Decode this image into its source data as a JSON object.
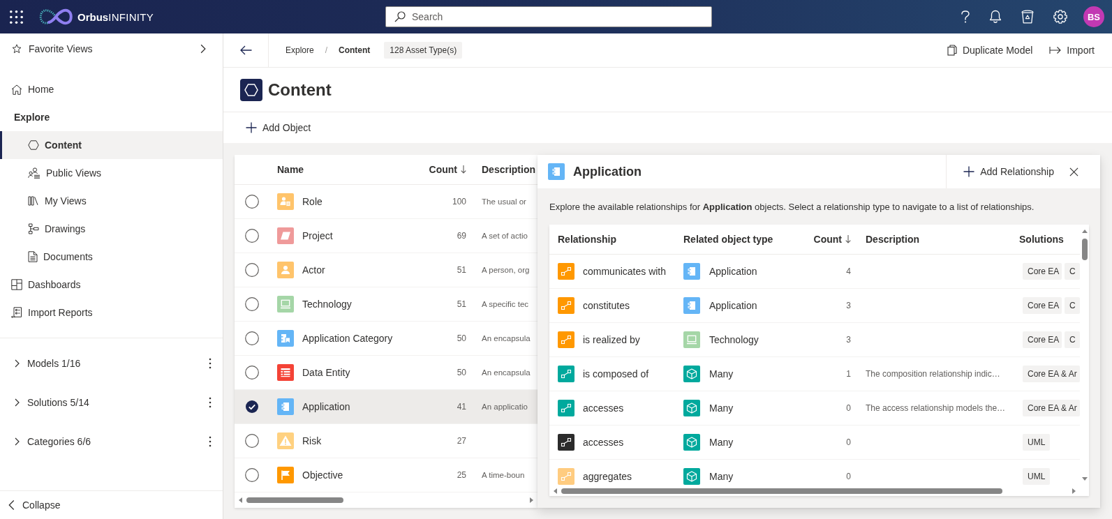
{
  "top_bar": {
    "logo": "**Orbus**INFINITY",
    "search": {
      "placeholder": "Search"
    },
    "avatar": "BS"
  },
  "sidebar": {
    "favorites": "Favorite Views",
    "nav": [
      {
        "label": "Home",
        "kind": "home",
        "selected": false
      },
      {
        "label": "Explore",
        "kind": "section",
        "selected": false,
        "children": [
          {
            "label": "Content",
            "kind": "hexagon",
            "selected": true
          },
          {
            "label": "Public Views",
            "kind": "people",
            "selected": false
          },
          {
            "label": "My Views",
            "kind": "books",
            "selected": false
          },
          {
            "label": "Drawings",
            "kind": "diagram",
            "selected": false
          },
          {
            "label": "Documents",
            "kind": "document",
            "selected": false
          }
        ]
      },
      {
        "label": "Dashboards",
        "kind": "dashboard",
        "selected": false
      },
      {
        "label": "Import Reports",
        "kind": "report",
        "selected": false
      }
    ],
    "groups": [
      {
        "label": "Models 1/16",
        "expanded": false
      },
      {
        "label": "Solutions 5/14",
        "expanded": false
      },
      {
        "label": "Categories 6/6",
        "expanded": false
      }
    ],
    "collapse": "Collapse"
  },
  "breadcrumb": {
    "items": [
      {
        "label": "Explore",
        "current": false
      },
      {
        "label": "Content",
        "current": true
      }
    ],
    "separator": "/",
    "badge": "128 Asset Type(s)",
    "actions": [
      {
        "label": "Duplicate Model",
        "kind": "duplicate"
      },
      {
        "label": "Import",
        "kind": "import"
      }
    ]
  },
  "page_title": "Content",
  "toolbar": [
    {
      "label": "Add Object",
      "kind": "add"
    }
  ],
  "content_table": {
    "columns": [
      {
        "label": "Name",
        "sorted": false
      },
      {
        "label": "Count",
        "sorted": true
      },
      {
        "label": "Description"
      }
    ],
    "rows": [
      {
        "selected": false,
        "kind": "role",
        "color": "#ffc46b",
        "name": "Role",
        "count": "100",
        "description": "The usual or"
      },
      {
        "selected": false,
        "kind": "project",
        "color": "#ef9a9a",
        "name": "Project",
        "count": "69",
        "description": "A set of actio"
      },
      {
        "selected": false,
        "kind": "actor",
        "color": "#ffc46b",
        "name": "Actor",
        "count": "51",
        "description": "A person, org"
      },
      {
        "selected": false,
        "kind": "technology",
        "color": "#a5d6a7",
        "name": "Technology",
        "count": "51",
        "description": "A specific tec"
      },
      {
        "selected": false,
        "kind": "application_category",
        "color": "#64b5f6",
        "name": "Application Category",
        "count": "50",
        "description": "An encapsula"
      },
      {
        "selected": false,
        "kind": "data_entity",
        "color": "#f44336",
        "name": "Data Entity",
        "count": "50",
        "description": "An encapsula"
      },
      {
        "selected": true,
        "kind": "application",
        "color": "#64b5f6",
        "name": "Application",
        "count": "41",
        "description": "An applicatio"
      },
      {
        "selected": false,
        "kind": "risk",
        "color": "#ffd180",
        "name": "Risk",
        "count": "27"
      },
      {
        "selected": false,
        "kind": "objective",
        "color": "#ff9800",
        "name": "Objective",
        "count": "25",
        "description": "A time-boun"
      }
    ]
  },
  "relationships_panel": {
    "title": "Application",
    "kind": "application",
    "color": "#64b5f6",
    "action": "Add Relationship",
    "intro": "Explore the available relationships for **Application** objects. Select a relationship type to navigate to a list of relationships.",
    "columns": [
      {
        "label": "Relationship",
        "sorted": false
      },
      {
        "label": "Related object type",
        "sorted": false
      },
      {
        "label": "Count",
        "sorted": true
      },
      {
        "label": "Description",
        "sorted": false
      },
      {
        "label": "Solutions",
        "sorted": false
      }
    ],
    "rows": [
      {
        "relationship": "communicates with",
        "color": "#ff9800",
        "related": {
          "label": "Application",
          "kind": "application",
          "color": "#64b5f6"
        },
        "count": "4",
        "solutions": [
          "Core EA",
          "C"
        ]
      },
      {
        "relationship": "constitutes",
        "color": "#ff9800",
        "related": {
          "label": "Application",
          "kind": "application",
          "color": "#64b5f6"
        },
        "count": "3",
        "solutions": [
          "Core EA",
          "C"
        ]
      },
      {
        "relationship": "is realized by",
        "color": "#ff9800",
        "related": {
          "label": "Technology",
          "kind": "technology",
          "color": "#a5d6a7"
        },
        "count": "3",
        "solutions": [
          "Core EA",
          "C"
        ]
      },
      {
        "relationship": "is composed of",
        "color": "#00a99d",
        "related": {
          "label": "Many",
          "kind": "many",
          "color": "#00a99d"
        },
        "count": "1",
        "description": "The composition relationship indic…",
        "solutions": [
          "Core EA & Ar"
        ]
      },
      {
        "relationship": "accesses",
        "color": "#00a99d",
        "related": {
          "label": "Many",
          "kind": "many",
          "color": "#00a99d"
        },
        "count": "0",
        "description": "The access relationship models the…",
        "solutions": [
          "Core EA & Ar"
        ]
      },
      {
        "relationship": "accesses",
        "color": "#2b2b2b",
        "related": {
          "label": "Many",
          "kind": "many",
          "color": "#00a99d"
        },
        "count": "0",
        "solutions": [
          "UML"
        ]
      },
      {
        "relationship": "aggregates",
        "color": "#ffcc80",
        "related": {
          "label": "Many",
          "kind": "many",
          "color": "#00a99d"
        },
        "count": "0",
        "solutions": [
          "UML"
        ]
      }
    ]
  }
}
